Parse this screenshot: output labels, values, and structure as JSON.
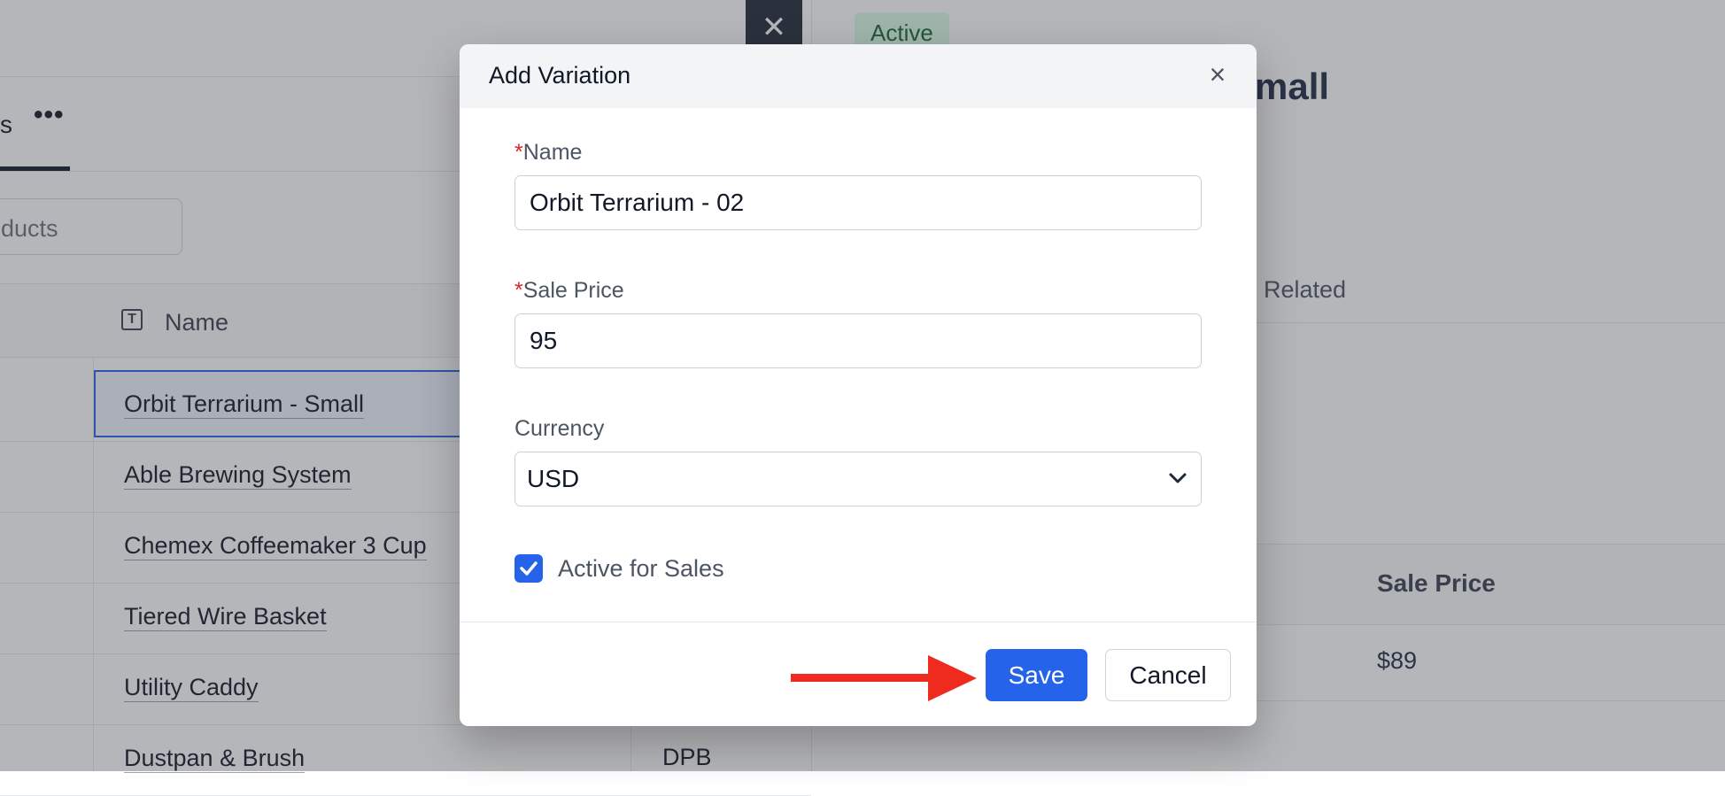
{
  "background": {
    "left_panel": {
      "tab_partial_label": "s",
      "more_label": "•••",
      "search_placeholder_partial": "ducts",
      "column_header": "Name",
      "column_icon": "text-type-icon",
      "rows": [
        {
          "name": "Orbit Terrarium - Small",
          "code": ""
        },
        {
          "name": "Able Brewing System",
          "code": ""
        },
        {
          "name": "Chemex Coffeemaker 3 Cup",
          "code": ""
        },
        {
          "name": "Tiered Wire Basket",
          "code": ""
        },
        {
          "name": "Utility Caddy",
          "code": ""
        },
        {
          "name": "Dustpan & Brush",
          "code": "DPB"
        }
      ],
      "close_label": "✕"
    },
    "right_panel": {
      "status": "Active",
      "title_partial": "mall",
      "tab_related": "Related",
      "table_header_sale_price": "Sale Price",
      "table_row_sale_price": "$89"
    }
  },
  "modal": {
    "title": "Add Variation",
    "close_icon": "close-icon",
    "close_label": "×",
    "name_field": {
      "required_mark": "*",
      "label": "Name",
      "value": "Orbit Terrarium - 02"
    },
    "sale_price_field": {
      "required_mark": "*",
      "label": "Sale Price",
      "value": "95"
    },
    "currency_field": {
      "label": "Currency",
      "value": "USD"
    },
    "active_for_sales": {
      "label": "Active for Sales",
      "checked": true
    },
    "save_label": "Save",
    "cancel_label": "Cancel"
  },
  "colors": {
    "primary": "#2563eb",
    "required": "#dc2626",
    "annotation_arrow": "#ef2b20",
    "badge_bg": "#dcfce7",
    "badge_text": "#166534"
  }
}
